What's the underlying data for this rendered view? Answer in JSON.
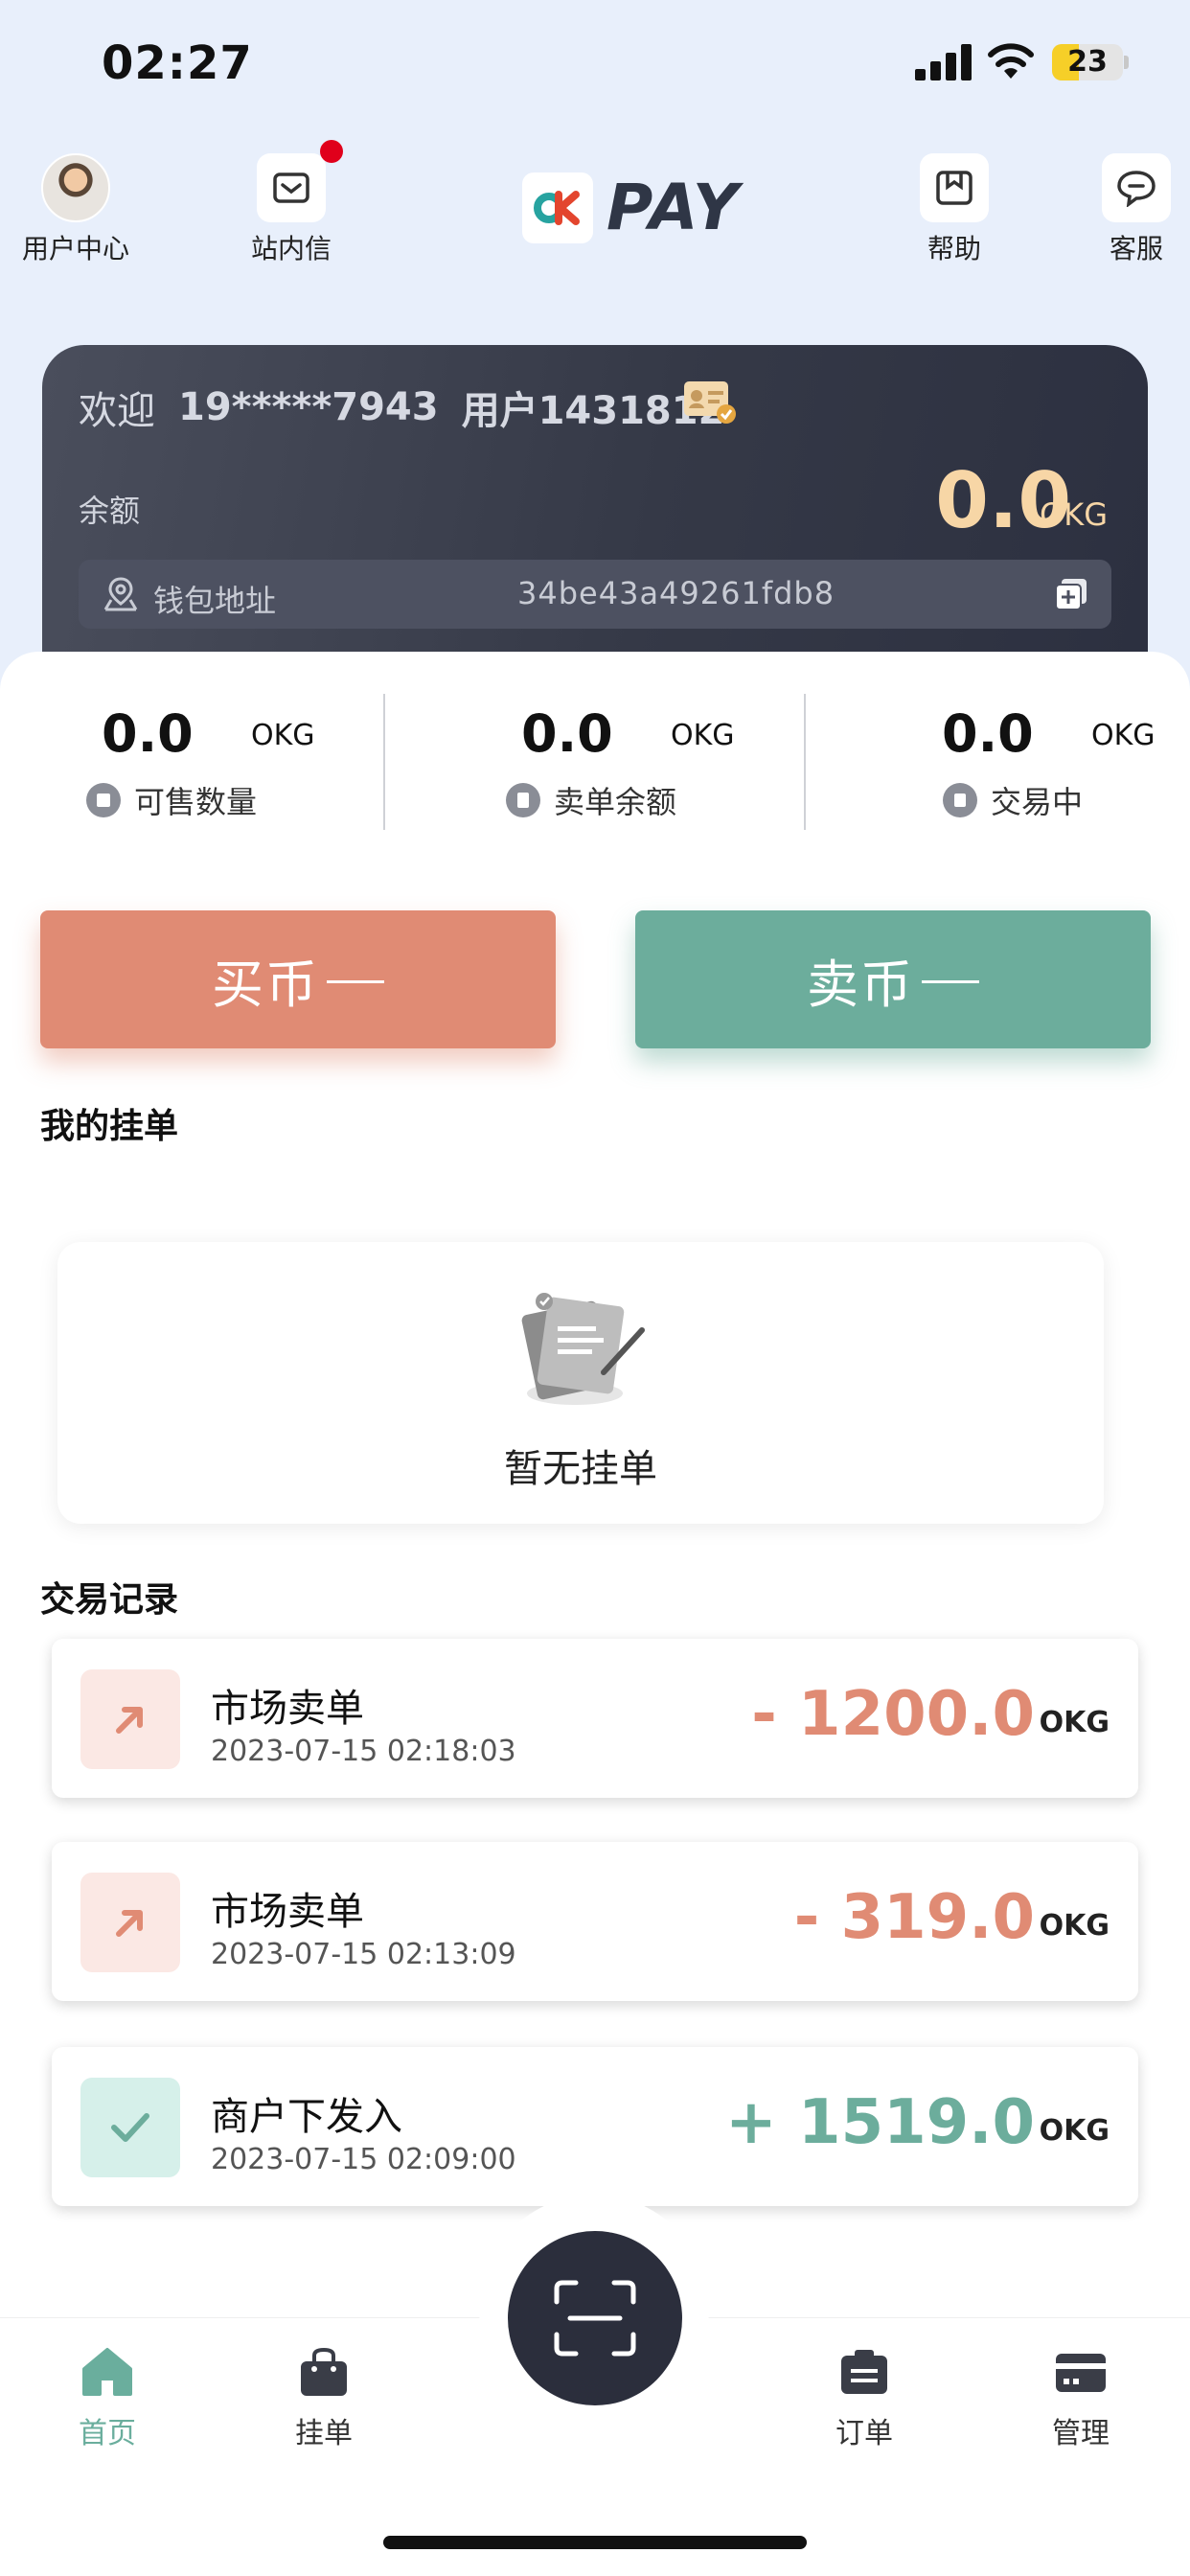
{
  "status_bar": {
    "time": "02:27",
    "battery": "23"
  },
  "header": {
    "user_center": "用户中心",
    "inbox": "站内信",
    "logo_text": "PAY",
    "help": "帮助",
    "service": "客服"
  },
  "account": {
    "welcome": "欢迎",
    "phone": "19*****7943",
    "username": "用户1431812",
    "balance_label": "余额",
    "balance_value": "0.0",
    "balance_unit": "OKG",
    "wallet_label": "钱包地址",
    "wallet_address": "34be43a49261fdb8"
  },
  "stats": [
    {
      "value": "0.0",
      "unit": "OKG",
      "label": "可售数量"
    },
    {
      "value": "0.0",
      "unit": "OKG",
      "label": "卖单余额"
    },
    {
      "value": "0.0",
      "unit": "OKG",
      "label": "交易中"
    }
  ],
  "actions": {
    "buy": "买币",
    "sell": "卖币"
  },
  "my_orders": {
    "title": "我的挂单",
    "empty": "暂无挂单"
  },
  "records": {
    "title": "交易记录",
    "items": [
      {
        "title": "市场卖单",
        "date": "2023-07-15 02:18:03",
        "amount": "- 1200.0",
        "unit": "OKG",
        "type": "out"
      },
      {
        "title": "市场卖单",
        "date": "2023-07-15 02:13:09",
        "amount": "- 319.0",
        "unit": "OKG",
        "type": "out"
      },
      {
        "title": "商户下发入",
        "date": "2023-07-15 02:09:00",
        "amount": "+ 1519.0",
        "unit": "OKG",
        "type": "in"
      }
    ]
  },
  "tabbar": {
    "home": "首页",
    "orders_list": "挂单",
    "orders": "订单",
    "manage": "管理"
  },
  "colors": {
    "buy": "#e08b74",
    "sell": "#6cad9c",
    "dark_card": "#353947",
    "balance": "#f7d6a6"
  }
}
